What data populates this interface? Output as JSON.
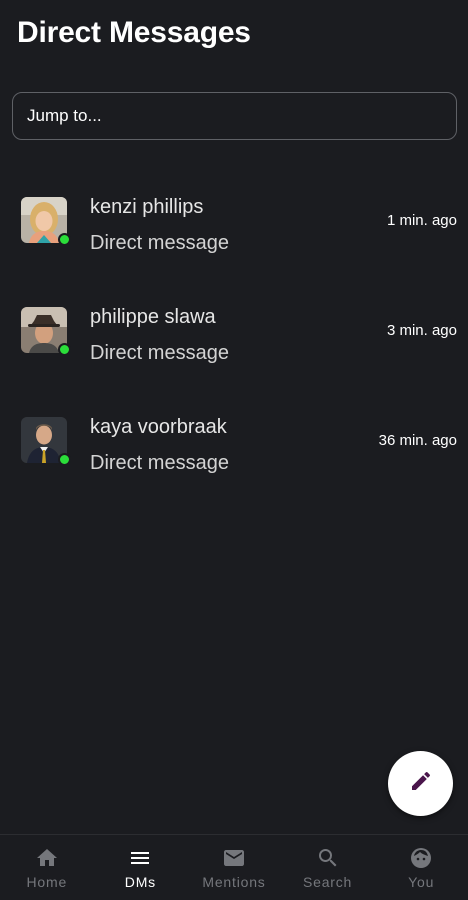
{
  "header": {
    "title": "Direct Messages"
  },
  "search": {
    "placeholder": "Jump to..."
  },
  "conversations": [
    {
      "name": "kenzi phillips",
      "subtitle": "Direct message",
      "time": "1 min. ago",
      "online": true
    },
    {
      "name": "philippe slawa",
      "subtitle": "Direct message",
      "time": "3 min. ago",
      "online": true
    },
    {
      "name": "kaya voorbraak",
      "subtitle": "Direct message",
      "time": "36 min. ago",
      "online": true
    }
  ],
  "tabs": [
    {
      "label": "Home",
      "icon": "home-icon",
      "active": false
    },
    {
      "label": "DMs",
      "icon": "menu-icon",
      "active": true
    },
    {
      "label": "Mentions",
      "icon": "mail-icon",
      "active": false
    },
    {
      "label": "Search",
      "icon": "search-icon",
      "active": false
    },
    {
      "label": "You",
      "icon": "face-icon",
      "active": false
    }
  ],
  "colors": {
    "background": "#1b1c20",
    "presence": "#2bde3a",
    "fab_icon": "#4a154b",
    "tab_inactive": "#75777c",
    "tab_active": "#ffffff"
  }
}
